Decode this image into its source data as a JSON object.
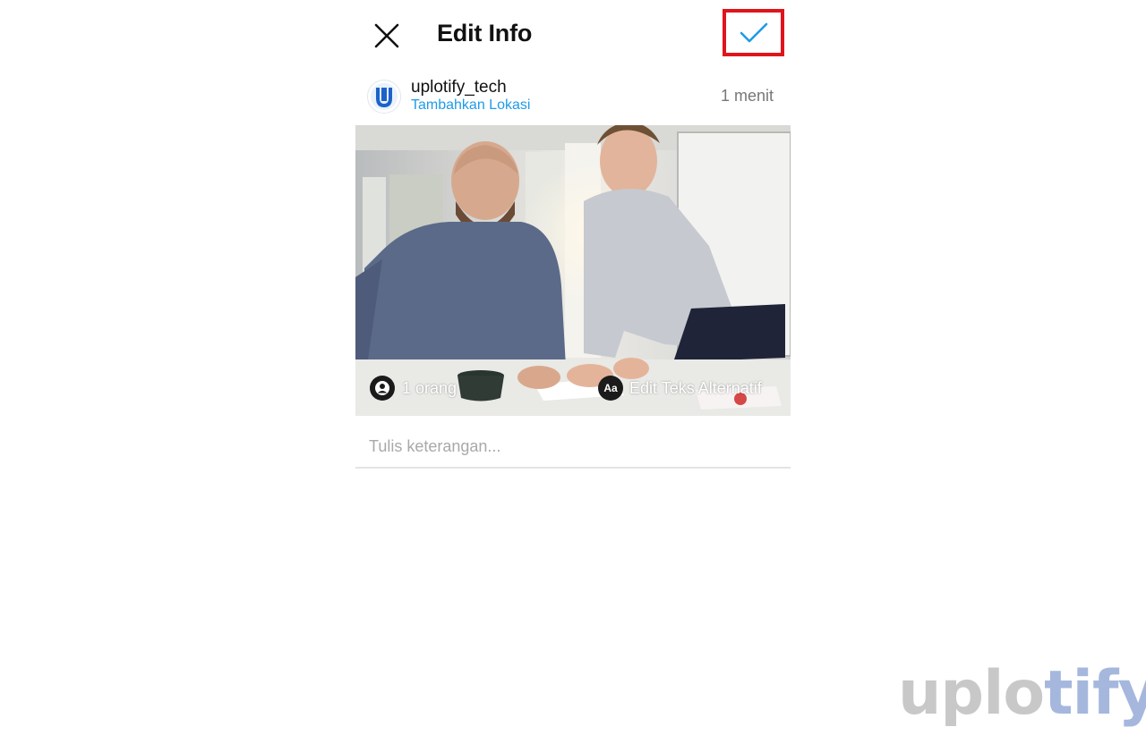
{
  "header": {
    "title": "Edit Info",
    "close_icon": "close-icon",
    "confirm_icon": "checkmark-icon",
    "confirm_highlight_color": "#e0141c",
    "confirm_icon_color": "#1e9be8"
  },
  "post": {
    "username": "uplotify_tech",
    "location_link": "Tambahkan Lokasi",
    "time": "1 menit",
    "avatar_icon": "uplotify-logo-icon",
    "link_color": "#1e9be8"
  },
  "photo": {
    "tag_people_label": "1 orang",
    "tag_people_icon": "person-icon",
    "alt_text_badge": "Aa",
    "alt_text_label": "Edit Teks Alternatif"
  },
  "caption": {
    "placeholder": "Tulis keterangan...",
    "value": ""
  },
  "watermark": {
    "part1": "uplo",
    "part2": "tify"
  }
}
